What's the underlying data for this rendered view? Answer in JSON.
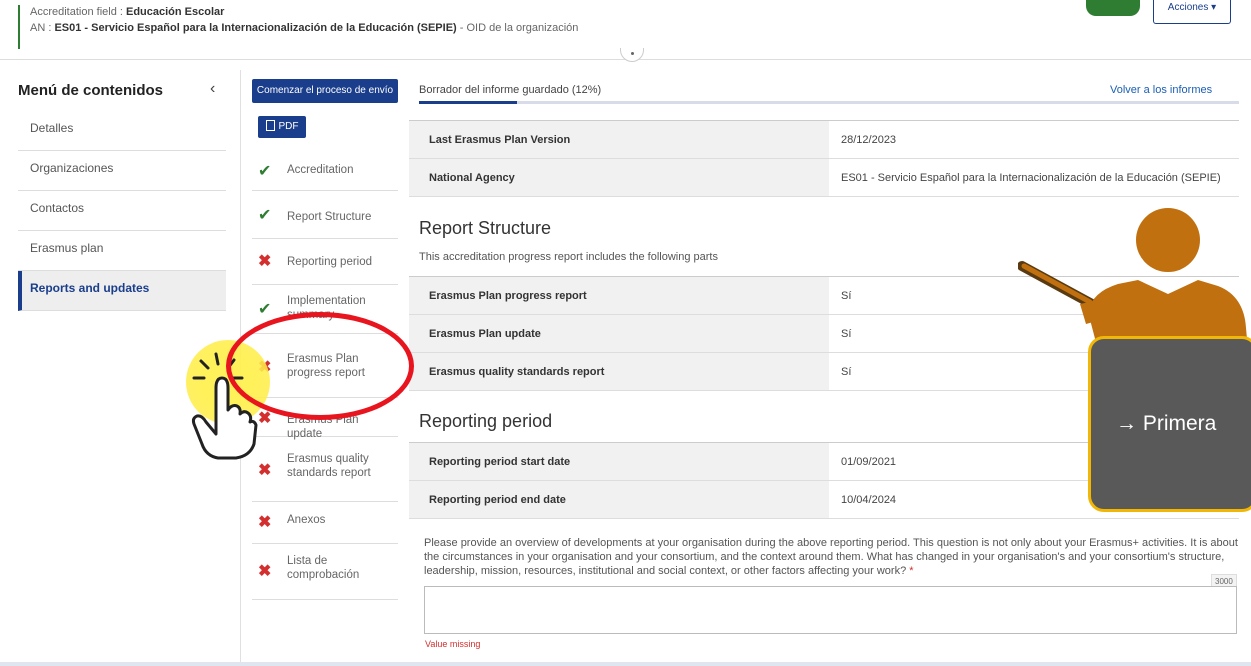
{
  "header": {
    "field_label": "Accreditation field : ",
    "field_value": "Educación Escolar",
    "an_label": "AN : ",
    "an_value": "ES01 - Servicio Español para la Internacionalización de la Educación (SEPIE)",
    "oid_text": " - OID de la organización",
    "actions_label": "Acciones"
  },
  "menu": {
    "title": "Menú de contenidos",
    "collapse_icon": "chevron-left-icon",
    "items": [
      {
        "label": "Detalles",
        "active": false
      },
      {
        "label": "Organizaciones",
        "active": false
      },
      {
        "label": "Contactos",
        "active": false
      },
      {
        "label": "Erasmus plan",
        "active": false
      },
      {
        "label": "Reports and updates",
        "active": true
      }
    ]
  },
  "steps": {
    "submit_label": "Comenzar el proceso de envío",
    "pdf_label": "PDF",
    "items": [
      {
        "label": "Accreditation",
        "status": "ok"
      },
      {
        "label": "Report Structure",
        "status": "ok"
      },
      {
        "label": "Reporting period",
        "status": "error"
      },
      {
        "label": "Implementation summary",
        "status": "ok"
      },
      {
        "label": "Erasmus Plan progress report",
        "status": "error"
      },
      {
        "label": "Erasmus Plan update",
        "status": "error"
      },
      {
        "label": "Erasmus quality standards report",
        "status": "error"
      },
      {
        "label": "Anexos",
        "status": "error"
      },
      {
        "label": "Lista de comprobación",
        "status": "error"
      }
    ]
  },
  "main": {
    "status_text": "Borrador del informe guardado (12%)",
    "progress_percent": 12,
    "back_link": "Volver a los informes",
    "info_rows": [
      {
        "key": "Last Erasmus Plan Version",
        "value": "28/12/2023"
      },
      {
        "key": "National Agency",
        "value": "ES01 - Servicio Español para la Internacionalización de la Educación (SEPIE)"
      }
    ],
    "report_structure": {
      "title": "Report Structure",
      "subtitle": "This accreditation progress report includes the following parts",
      "rows": [
        {
          "key": "Erasmus Plan progress report",
          "value": "Sí"
        },
        {
          "key": "Erasmus Plan update",
          "value": "Sí"
        },
        {
          "key": "Erasmus quality standards report",
          "value": "Sí"
        }
      ]
    },
    "reporting_period": {
      "title": "Reporting period",
      "rows": [
        {
          "key": "Reporting period start date",
          "value": "01/09/2021"
        },
        {
          "key": "Reporting period end date",
          "value": "10/04/2024"
        }
      ]
    },
    "question_text": "Please provide an overview of developments at your organisation during the above reporting period. This question is not only about your Erasmus+ activities. It is about the circumstances in your organisation and your consortium, and the context around them. What has changed in your organisation's and your consortium's structure, leadership, mission, resources, institutional and social context, or other factors affecting your work?",
    "required_mark": "*",
    "char_counter": "3000",
    "error_text": "Value missing"
  },
  "overlay": {
    "callout_text": "→ Primera",
    "callout_color": "#595959",
    "callout_border": "#f2b705",
    "ellipse_color": "#e8141e",
    "presenter_color": "#c0700f"
  },
  "colors": {
    "primary": "#1a3e8c",
    "success": "#2e7d32",
    "error": "#d32f2f"
  }
}
